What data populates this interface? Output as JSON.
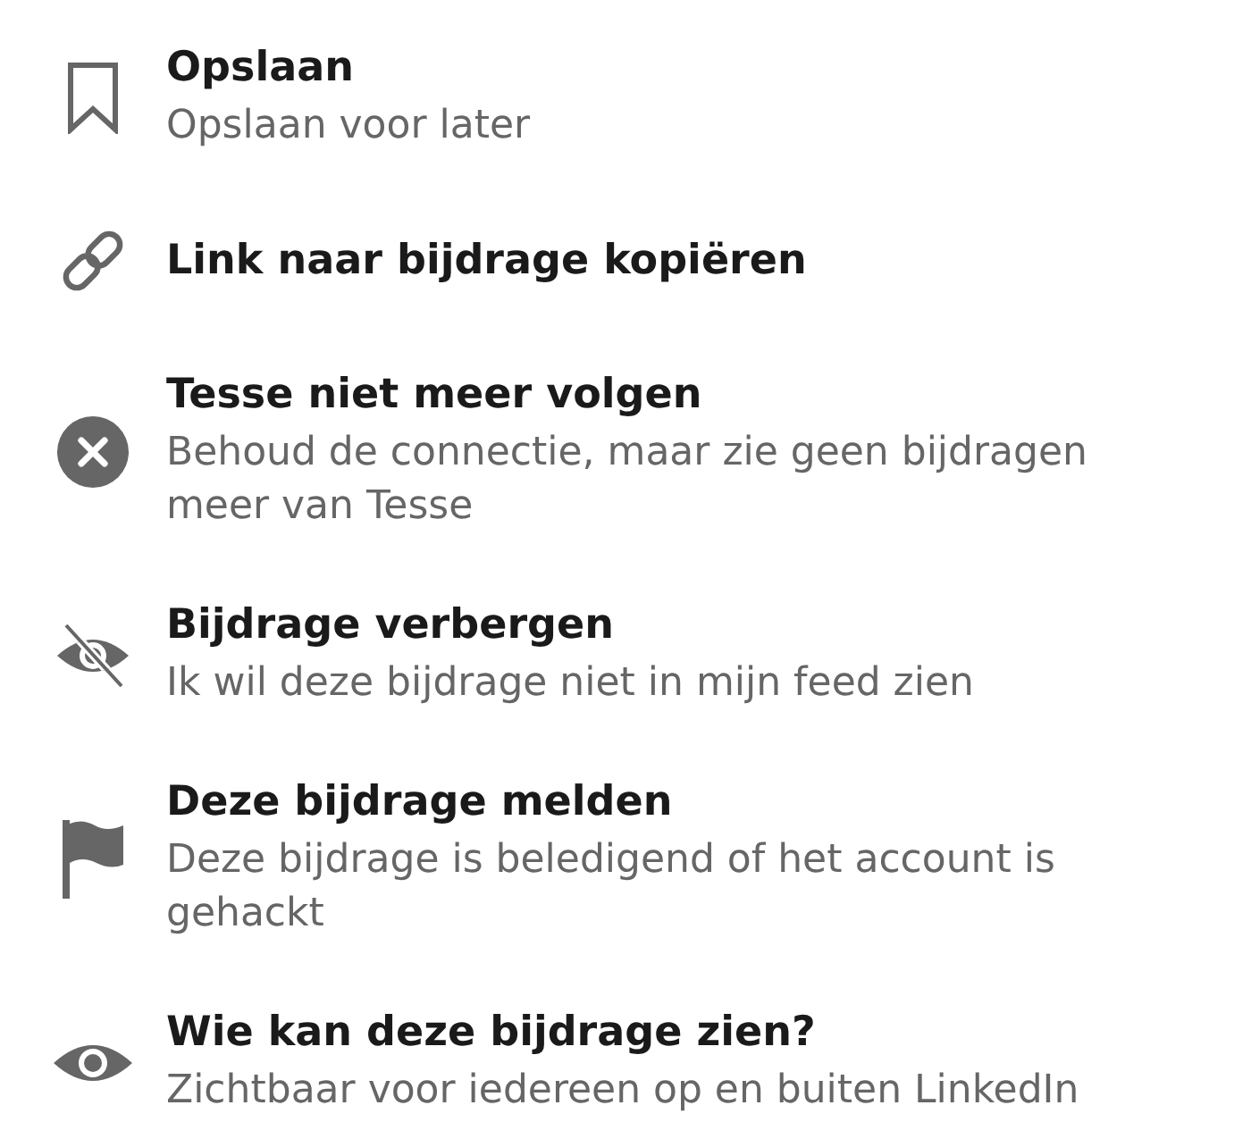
{
  "menu": {
    "items": [
      {
        "title": "Opslaan",
        "description": "Opslaan voor later"
      },
      {
        "title": "Link naar bijdrage kopiëren"
      },
      {
        "title": "Tesse niet meer volgen",
        "description": "Behoud de connectie, maar zie geen bijdragen meer van Tesse"
      },
      {
        "title": "Bijdrage verbergen",
        "description": "Ik wil deze bijdrage niet in mijn feed zien"
      },
      {
        "title": "Deze bijdrage melden",
        "description": "Deze bijdrage is beledigend of het account is gehackt"
      },
      {
        "title": "Wie kan deze bijdrage zien?",
        "description": "Zichtbaar voor iedereen op en buiten LinkedIn"
      }
    ]
  }
}
